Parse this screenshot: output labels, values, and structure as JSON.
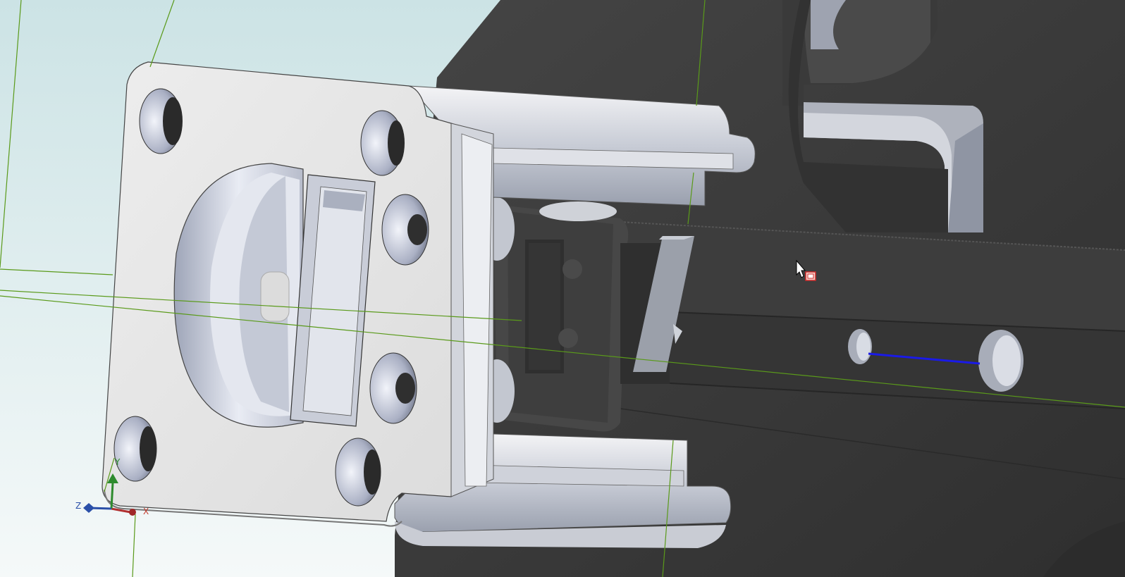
{
  "window": {
    "type": "cad-3d-viewport"
  },
  "triad": {
    "x_label": "X",
    "y_label": "Y",
    "z_label": "Z",
    "colors": {
      "x": "#c0392b",
      "y": "#2e8b2e",
      "z": "#2a4fa8"
    }
  },
  "colors": {
    "background_top": "#cfe6e8",
    "background_bottom": "#f3f8f8",
    "part_light": "#e6e6e6",
    "part_dark": "#3a3a3a",
    "sketch_line": "#5a9a1a",
    "highlight_edge": "#1010e0"
  },
  "cursor": {
    "icon": "pointer-cursor-with-part-icon"
  }
}
